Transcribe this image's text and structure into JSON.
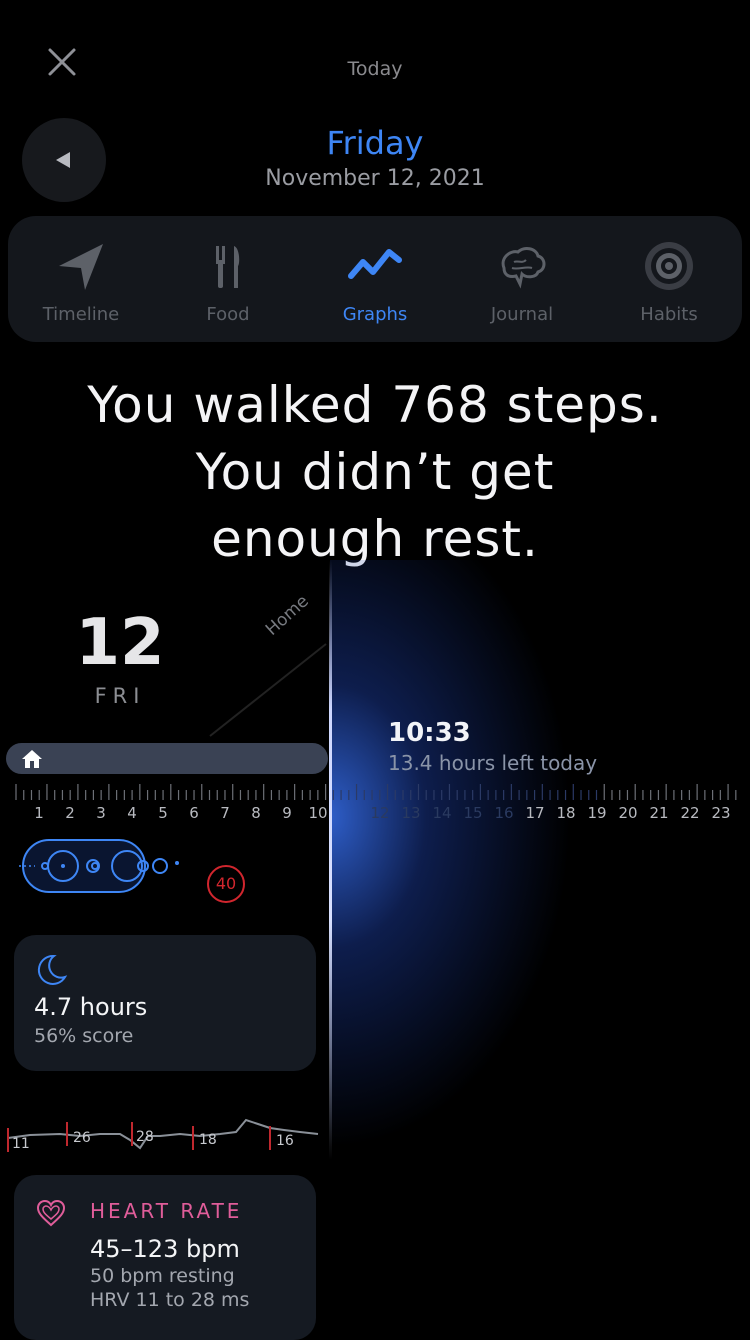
{
  "header": {
    "today_label": "Today",
    "day_title": "Friday",
    "date": "November 12, 2021"
  },
  "tabs": [
    {
      "label": "Timeline",
      "icon": "navigation-arrow-icon"
    },
    {
      "label": "Food",
      "icon": "fork-knife-icon"
    },
    {
      "label": "Graphs",
      "icon": "graph-line-icon",
      "active": true
    },
    {
      "label": "Journal",
      "icon": "brain-icon"
    },
    {
      "label": "Habits",
      "icon": "target-icon"
    }
  ],
  "headline": {
    "line1": "You walked 768 steps.",
    "line2": "You didn’t get",
    "line3": "enough rest."
  },
  "timeline": {
    "day_number": "12",
    "day_name": "FRI",
    "location_label": "Home",
    "current_time": "10:33",
    "time_left": "13.4 hours left today",
    "hours": [
      "1",
      "2",
      "3",
      "4",
      "5",
      "6",
      "7",
      "8",
      "9",
      "10",
      "12",
      "13",
      "14",
      "15",
      "16",
      "17",
      "18",
      "19",
      "20",
      "21",
      "22",
      "23"
    ],
    "steps_badge": "40"
  },
  "sleep": {
    "hours": "4.7 hours",
    "score": "56% score"
  },
  "hr_graph": {
    "labels": [
      "11",
      "26",
      "28",
      "18",
      "16"
    ]
  },
  "heart_rate": {
    "title": "HEART RATE",
    "range": "45–123 bpm",
    "resting": "50 bpm resting",
    "hrv": "HRV 11 to 28 ms"
  },
  "colors": {
    "accent_blue": "#3e86f5",
    "heart_pink": "#e05d9a",
    "alert_red": "#d1262e"
  }
}
